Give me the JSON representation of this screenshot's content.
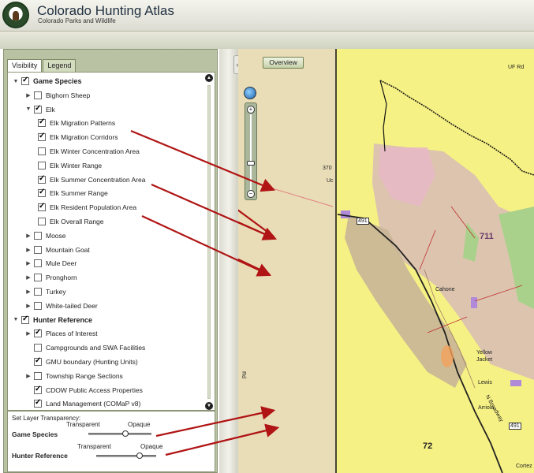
{
  "app": {
    "title": "Colorado Hunting Atlas",
    "subtitle": "Colorado Parks and Wildlife"
  },
  "tabs": [
    {
      "label": "Visibility",
      "active": true
    },
    {
      "label": "Legend",
      "active": false
    }
  ],
  "layers": [
    {
      "label": "Game Species",
      "checked": true,
      "level": 0,
      "expander": "minus",
      "bold": true
    },
    {
      "label": "Bighorn Sheep",
      "checked": false,
      "level": 1,
      "expander": "plus"
    },
    {
      "label": "Elk",
      "checked": true,
      "level": 1,
      "expander": "minus"
    },
    {
      "label": "Elk Migration Patterns",
      "checked": true,
      "level": 2,
      "expander": ""
    },
    {
      "label": "Elk Migration Corridors",
      "checked": true,
      "level": 2,
      "expander": ""
    },
    {
      "label": "Elk Winter Concentration Area",
      "checked": false,
      "level": 2,
      "expander": ""
    },
    {
      "label": "Elk Winter Range",
      "checked": false,
      "level": 2,
      "expander": ""
    },
    {
      "label": "Elk Summer Concentration Area",
      "checked": true,
      "level": 2,
      "expander": ""
    },
    {
      "label": "Elk Summer Range",
      "checked": true,
      "level": 2,
      "expander": ""
    },
    {
      "label": "Elk Resident Population Area",
      "checked": true,
      "level": 2,
      "expander": ""
    },
    {
      "label": "Elk Overall Range",
      "checked": false,
      "level": 2,
      "expander": ""
    },
    {
      "label": "Moose",
      "checked": false,
      "level": 1,
      "expander": "plus"
    },
    {
      "label": "Mountain Goat",
      "checked": false,
      "level": 1,
      "expander": "plus"
    },
    {
      "label": "Mule Deer",
      "checked": false,
      "level": 1,
      "expander": "plus"
    },
    {
      "label": "Pronghorn",
      "checked": false,
      "level": 1,
      "expander": "plus"
    },
    {
      "label": "Turkey",
      "checked": false,
      "level": 1,
      "expander": "plus"
    },
    {
      "label": "White-tailed Deer",
      "checked": false,
      "level": 1,
      "expander": "plus"
    },
    {
      "label": "Hunter Reference",
      "checked": true,
      "level": 0,
      "expander": "minus",
      "bold": true
    },
    {
      "label": "Places of Interest",
      "checked": true,
      "level": 1,
      "expander": "plus"
    },
    {
      "label": "Campgrounds and SWA Facilities",
      "checked": false,
      "level": 1,
      "expander": ""
    },
    {
      "label": "GMU boundary (Hunting Units)",
      "checked": true,
      "level": 1,
      "expander": ""
    },
    {
      "label": "Township Range Sections",
      "checked": false,
      "level": 1,
      "expander": "plus"
    },
    {
      "label": "CDOW Public Access Properties",
      "checked": true,
      "level": 1,
      "expander": ""
    },
    {
      "label": "Land Management (COMaP v8)",
      "checked": true,
      "level": 1,
      "expander": ""
    }
  ],
  "transparency": {
    "title": "Set Layer Transparency:",
    "rows": [
      {
        "label": "Game Species",
        "left": "Transparent",
        "right": "Opaque",
        "value": 0.6
      },
      {
        "label": "Hunter Reference",
        "left": "Transparent",
        "right": "Opaque",
        "value": 0.75
      }
    ]
  },
  "map": {
    "overview_label": "Overview",
    "zoom_level_fraction": 0.35,
    "labels": [
      "370",
      "Uc",
      "711",
      "Cahone",
      "Yellow",
      "Jacket",
      "Lewis",
      "Arriola",
      "N Broadway",
      "72",
      "491",
      "491",
      "UF Rd",
      "Cortez",
      "Rd"
    ]
  },
  "colors": {
    "panel_bg": "#b9c3a3",
    "map_terrain": "#e9ddb8",
    "map_yellow": "#f4f08a",
    "map_pink": "#e8c4c4",
    "map_green": "#a9d18b",
    "arrow_red": "#b01414"
  }
}
